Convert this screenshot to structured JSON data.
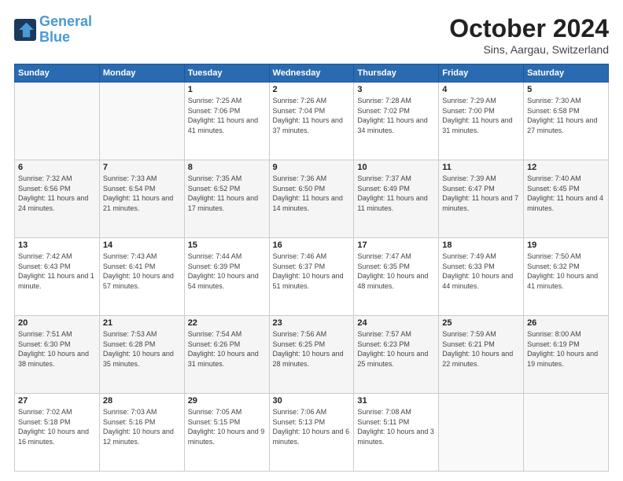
{
  "header": {
    "logo_line1": "General",
    "logo_line2": "Blue",
    "month": "October 2024",
    "location": "Sins, Aargau, Switzerland"
  },
  "weekdays": [
    "Sunday",
    "Monday",
    "Tuesday",
    "Wednesday",
    "Thursday",
    "Friday",
    "Saturday"
  ],
  "weeks": [
    [
      {
        "day": "",
        "info": ""
      },
      {
        "day": "",
        "info": ""
      },
      {
        "day": "1",
        "info": "Sunrise: 7:25 AM\nSunset: 7:06 PM\nDaylight: 11 hours and 41 minutes."
      },
      {
        "day": "2",
        "info": "Sunrise: 7:26 AM\nSunset: 7:04 PM\nDaylight: 11 hours and 37 minutes."
      },
      {
        "day": "3",
        "info": "Sunrise: 7:28 AM\nSunset: 7:02 PM\nDaylight: 11 hours and 34 minutes."
      },
      {
        "day": "4",
        "info": "Sunrise: 7:29 AM\nSunset: 7:00 PM\nDaylight: 11 hours and 31 minutes."
      },
      {
        "day": "5",
        "info": "Sunrise: 7:30 AM\nSunset: 6:58 PM\nDaylight: 11 hours and 27 minutes."
      }
    ],
    [
      {
        "day": "6",
        "info": "Sunrise: 7:32 AM\nSunset: 6:56 PM\nDaylight: 11 hours and 24 minutes."
      },
      {
        "day": "7",
        "info": "Sunrise: 7:33 AM\nSunset: 6:54 PM\nDaylight: 11 hours and 21 minutes."
      },
      {
        "day": "8",
        "info": "Sunrise: 7:35 AM\nSunset: 6:52 PM\nDaylight: 11 hours and 17 minutes."
      },
      {
        "day": "9",
        "info": "Sunrise: 7:36 AM\nSunset: 6:50 PM\nDaylight: 11 hours and 14 minutes."
      },
      {
        "day": "10",
        "info": "Sunrise: 7:37 AM\nSunset: 6:49 PM\nDaylight: 11 hours and 11 minutes."
      },
      {
        "day": "11",
        "info": "Sunrise: 7:39 AM\nSunset: 6:47 PM\nDaylight: 11 hours and 7 minutes."
      },
      {
        "day": "12",
        "info": "Sunrise: 7:40 AM\nSunset: 6:45 PM\nDaylight: 11 hours and 4 minutes."
      }
    ],
    [
      {
        "day": "13",
        "info": "Sunrise: 7:42 AM\nSunset: 6:43 PM\nDaylight: 11 hours and 1 minute."
      },
      {
        "day": "14",
        "info": "Sunrise: 7:43 AM\nSunset: 6:41 PM\nDaylight: 10 hours and 57 minutes."
      },
      {
        "day": "15",
        "info": "Sunrise: 7:44 AM\nSunset: 6:39 PM\nDaylight: 10 hours and 54 minutes."
      },
      {
        "day": "16",
        "info": "Sunrise: 7:46 AM\nSunset: 6:37 PM\nDaylight: 10 hours and 51 minutes."
      },
      {
        "day": "17",
        "info": "Sunrise: 7:47 AM\nSunset: 6:35 PM\nDaylight: 10 hours and 48 minutes."
      },
      {
        "day": "18",
        "info": "Sunrise: 7:49 AM\nSunset: 6:33 PM\nDaylight: 10 hours and 44 minutes."
      },
      {
        "day": "19",
        "info": "Sunrise: 7:50 AM\nSunset: 6:32 PM\nDaylight: 10 hours and 41 minutes."
      }
    ],
    [
      {
        "day": "20",
        "info": "Sunrise: 7:51 AM\nSunset: 6:30 PM\nDaylight: 10 hours and 38 minutes."
      },
      {
        "day": "21",
        "info": "Sunrise: 7:53 AM\nSunset: 6:28 PM\nDaylight: 10 hours and 35 minutes."
      },
      {
        "day": "22",
        "info": "Sunrise: 7:54 AM\nSunset: 6:26 PM\nDaylight: 10 hours and 31 minutes."
      },
      {
        "day": "23",
        "info": "Sunrise: 7:56 AM\nSunset: 6:25 PM\nDaylight: 10 hours and 28 minutes."
      },
      {
        "day": "24",
        "info": "Sunrise: 7:57 AM\nSunset: 6:23 PM\nDaylight: 10 hours and 25 minutes."
      },
      {
        "day": "25",
        "info": "Sunrise: 7:59 AM\nSunset: 6:21 PM\nDaylight: 10 hours and 22 minutes."
      },
      {
        "day": "26",
        "info": "Sunrise: 8:00 AM\nSunset: 6:19 PM\nDaylight: 10 hours and 19 minutes."
      }
    ],
    [
      {
        "day": "27",
        "info": "Sunrise: 7:02 AM\nSunset: 5:18 PM\nDaylight: 10 hours and 16 minutes."
      },
      {
        "day": "28",
        "info": "Sunrise: 7:03 AM\nSunset: 5:16 PM\nDaylight: 10 hours and 12 minutes."
      },
      {
        "day": "29",
        "info": "Sunrise: 7:05 AM\nSunset: 5:15 PM\nDaylight: 10 hours and 9 minutes."
      },
      {
        "day": "30",
        "info": "Sunrise: 7:06 AM\nSunset: 5:13 PM\nDaylight: 10 hours and 6 minutes."
      },
      {
        "day": "31",
        "info": "Sunrise: 7:08 AM\nSunset: 5:11 PM\nDaylight: 10 hours and 3 minutes."
      },
      {
        "day": "",
        "info": ""
      },
      {
        "day": "",
        "info": ""
      }
    ]
  ]
}
